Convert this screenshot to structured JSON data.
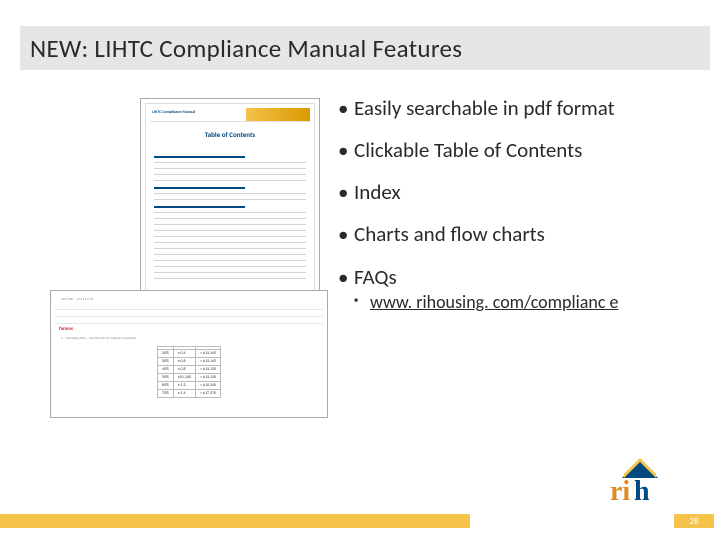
{
  "title": "NEW: LIHTC Compliance Manual Features",
  "bullets": [
    "Easily searchable in pdf format",
    "Clickable Table of Contents",
    "Index",
    "Charts and flow charts",
    "FAQs"
  ],
  "link": {
    "label": "www. rihousing. com/complianc e",
    "href": "http://www.rihousing.com/compliance"
  },
  "doc_preview": {
    "header_label": "LIHTC Compliance Manual",
    "toc_label": "Table of Contents"
  },
  "brand": "rih",
  "page_number": "28",
  "colors": {
    "accent": "#f5c24a",
    "brand_blue": "#004a80",
    "brand_orange": "#e08a1f"
  }
}
